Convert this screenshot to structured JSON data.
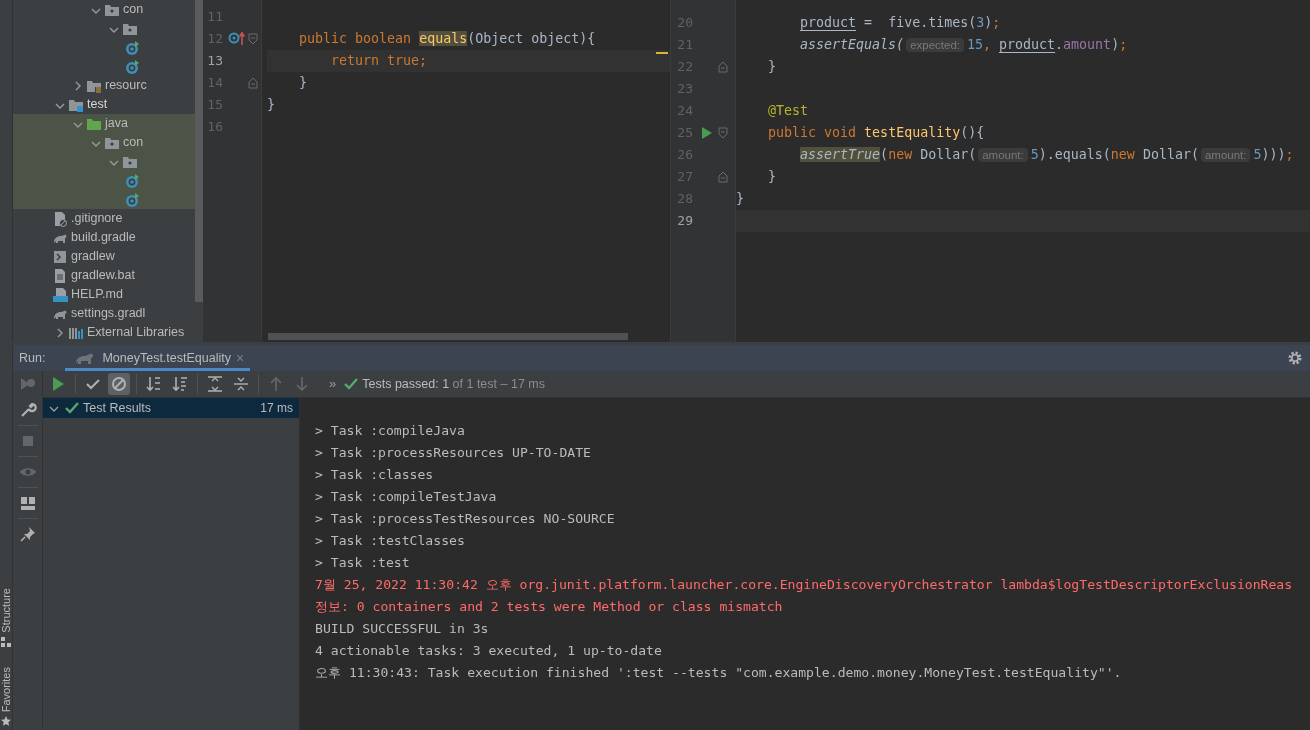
{
  "project_tree": [
    {
      "kind": "offscreen",
      "children": [
        {
          "kind": "offscreen",
          "children": [
            {
              "kind": "package",
              "label": "con",
              "highlighted": false,
              "expanded": true,
              "children": [
                {
                  "kind": "package",
                  "highlighted": false,
                  "expanded": true,
                  "children": [
                    {
                      "kind": "class",
                      "highlighted": false
                    },
                    {
                      "kind": "class",
                      "highlighted": false
                    }
                  ]
                }
              ]
            }
          ]
        },
        {
          "kind": "resources",
          "label": "resourc",
          "highlighted": false,
          "expanded": false
        }
      ]
    },
    {
      "kind": "test-root",
      "label": "test",
      "highlighted": false,
      "expanded": true,
      "children": [
        {
          "kind": "source",
          "label": "java",
          "highlighted": true,
          "expanded": true,
          "children": [
            {
              "kind": "package",
              "label": "con",
              "highlighted": true,
              "expanded": true,
              "children": [
                {
                  "kind": "package",
                  "highlighted": true,
                  "expanded": true,
                  "children": [
                    {
                      "kind": "class",
                      "highlighted": true
                    },
                    {
                      "kind": "class",
                      "highlighted": true
                    }
                  ]
                }
              ]
            }
          ]
        }
      ]
    },
    {
      "kind": "ignore",
      "label": ".gitignore",
      "highlighted": false
    },
    {
      "kind": "gradle",
      "label": "build.gradle",
      "highlighted": false
    },
    {
      "kind": "script",
      "label": "gradlew",
      "highlighted": false
    },
    {
      "kind": "text",
      "label": "gradlew.bat",
      "highlighted": false
    },
    {
      "kind": "markdown",
      "label": "HELP.md",
      "highlighted": false
    },
    {
      "kind": "gradle",
      "label": "settings.gradl",
      "highlighted": false
    },
    {
      "kind": "library",
      "label": "External Libraries",
      "highlighted": false,
      "expanded": false
    }
  ],
  "left_editor": {
    "lines": [
      {
        "number": "11",
        "current": false
      },
      {
        "number": "12",
        "current": false,
        "override_marker": true,
        "fold_start": true,
        "tokens": [
          {
            "kind": "keyword",
            "text": "    public boolean "
          },
          {
            "kind": "usage",
            "text": "equals"
          },
          {
            "kind": "plain",
            "text": "(Object object){"
          }
        ]
      },
      {
        "number": "13",
        "current": true,
        "tokens": [
          {
            "kind": "keyword",
            "text": "        return true;"
          }
        ]
      },
      {
        "number": "14",
        "current": false,
        "fold_end": true,
        "tokens": [
          {
            "kind": "plain",
            "text": "    }"
          }
        ]
      },
      {
        "number": "15",
        "current": false,
        "tokens": [
          {
            "kind": "plain",
            "text": "}"
          }
        ]
      },
      {
        "number": "16",
        "current": false
      }
    ]
  },
  "right_editor": {
    "lines": [
      {
        "number": "20",
        "current": false,
        "tokens": [
          {
            "kind": "local",
            "text": "        product"
          },
          {
            "kind": "plain",
            "text": " =  five.times("
          },
          {
            "kind": "number",
            "text": "3"
          },
          {
            "kind": "plain",
            "text": ")"
          },
          {
            "kind": "keyword",
            "text": ";"
          }
        ]
      },
      {
        "number": "21",
        "current": false,
        "tokens": [
          {
            "kind": "static",
            "text": "        assertEquals("
          },
          {
            "kind": "hint",
            "text": "expected:"
          },
          {
            "kind": "number",
            "text": "15"
          },
          {
            "kind": "keyword",
            "text": ", "
          },
          {
            "kind": "local",
            "text": "product"
          },
          {
            "kind": "plain",
            "text": "."
          },
          {
            "kind": "field",
            "text": "amount"
          },
          {
            "kind": "plain",
            "text": ")"
          },
          {
            "kind": "keyword",
            "text": ";"
          }
        ]
      },
      {
        "number": "22",
        "current": false,
        "fold_end": true,
        "tokens": [
          {
            "kind": "plain",
            "text": "    }"
          }
        ]
      },
      {
        "number": "23",
        "current": false
      },
      {
        "number": "24",
        "current": false,
        "tokens": [
          {
            "kind": "annotation",
            "text": "    @Test"
          }
        ]
      },
      {
        "number": "25",
        "current": false,
        "run_marker": true,
        "fold_start": true,
        "tokens": [
          {
            "kind": "keyword",
            "text": "    public void "
          },
          {
            "kind": "method",
            "text": "testEquality"
          },
          {
            "kind": "plain",
            "text": "(){"
          }
        ]
      },
      {
        "number": "26",
        "current": false,
        "tokens": [
          {
            "kind": "static-usage",
            "text": "        assertTrue"
          },
          {
            "kind": "plain",
            "text": "("
          },
          {
            "kind": "keyword",
            "text": "new "
          },
          {
            "kind": "plain",
            "text": "Dollar("
          },
          {
            "kind": "hint",
            "text": "amount:"
          },
          {
            "kind": "number",
            "text": "5"
          },
          {
            "kind": "plain",
            "text": ").equals("
          },
          {
            "kind": "keyword",
            "text": "new "
          },
          {
            "kind": "plain",
            "text": "Dollar("
          },
          {
            "kind": "hint",
            "text": "amount:"
          },
          {
            "kind": "number",
            "text": "5"
          },
          {
            "kind": "plain",
            "text": ")))"
          },
          {
            "kind": "keyword",
            "text": ";"
          }
        ]
      },
      {
        "number": "27",
        "current": false,
        "fold_end": true,
        "tokens": [
          {
            "kind": "plain",
            "text": "    }"
          }
        ]
      },
      {
        "number": "28",
        "current": false,
        "tokens": [
          {
            "kind": "plain",
            "text": "}"
          }
        ]
      },
      {
        "number": "29",
        "current": true
      }
    ]
  },
  "side_labels": [
    "Structure",
    "Favorites"
  ],
  "run_panel": {
    "label": "Run:",
    "tabs": [
      {
        "label": "MoneyTest.testEquality",
        "selected": true,
        "close": "×"
      }
    ],
    "toolbar": [
      {
        "kind": "rerun",
        "disabled": false,
        "pressed": false
      },
      {
        "kind": "sep"
      },
      {
        "kind": "show-passed",
        "disabled": false,
        "pressed": false
      },
      {
        "kind": "show-ignored",
        "disabled": false,
        "pressed": true
      },
      {
        "kind": "sep"
      },
      {
        "kind": "sort-alpha",
        "disabled": false,
        "pressed": false
      },
      {
        "kind": "sort-duration",
        "disabled": false,
        "pressed": false
      },
      {
        "kind": "sep"
      },
      {
        "kind": "expand-all",
        "disabled": false,
        "pressed": false
      },
      {
        "kind": "collapse-all",
        "disabled": false,
        "pressed": false
      },
      {
        "kind": "sep"
      },
      {
        "kind": "up",
        "disabled": true,
        "pressed": false
      },
      {
        "kind": "down",
        "disabled": true,
        "pressed": false
      }
    ],
    "more": "»",
    "status": {
      "label": "Tests passed:",
      "count": "1",
      "detail": "of 1 test – 17 ms"
    },
    "side_tools": [
      {
        "kind": "rerun-failed",
        "disabled": true
      },
      {
        "kind": "wrench",
        "disabled": false
      },
      {
        "kind": "sep"
      },
      {
        "kind": "stop",
        "disabled": true
      },
      {
        "kind": "sep"
      },
      {
        "kind": "eye",
        "disabled": true
      },
      {
        "kind": "sep"
      },
      {
        "kind": "layout",
        "disabled": false
      },
      {
        "kind": "sep"
      },
      {
        "kind": "pin",
        "disabled": false
      }
    ],
    "results": [
      {
        "label": "Test Results",
        "time": "17 ms",
        "selected": true,
        "expanded": true
      }
    ],
    "console": [
      {
        "kind": "out",
        "text": "> Task :compileJava"
      },
      {
        "kind": "out",
        "text": "> Task :processResources UP-TO-DATE"
      },
      {
        "kind": "out",
        "text": "> Task :classes"
      },
      {
        "kind": "out",
        "text": "> Task :compileTestJava"
      },
      {
        "kind": "out",
        "text": "> Task :processTestResources NO-SOURCE"
      },
      {
        "kind": "out",
        "text": "> Task :testClasses"
      },
      {
        "kind": "out",
        "text": "> Task :test"
      },
      {
        "kind": "err",
        "text": "7월 25, 2022 11:30:42 오후 org.junit.platform.launcher.core.EngineDiscoveryOrchestrator lambda$logTestDescriptorExclusionReas"
      },
      {
        "kind": "err",
        "text": "정보: 0 containers and 2 tests were Method or class mismatch"
      },
      {
        "kind": "out",
        "text": "BUILD SUCCESSFUL in 3s"
      },
      {
        "kind": "out",
        "text": "4 actionable tasks: 3 executed, 1 up-to-date"
      },
      {
        "kind": "out",
        "text": "오후 11:30:43: Task execution finished ':test --tests \"com.example.demo.money.MoneyTest.testEquality\"'."
      }
    ]
  }
}
